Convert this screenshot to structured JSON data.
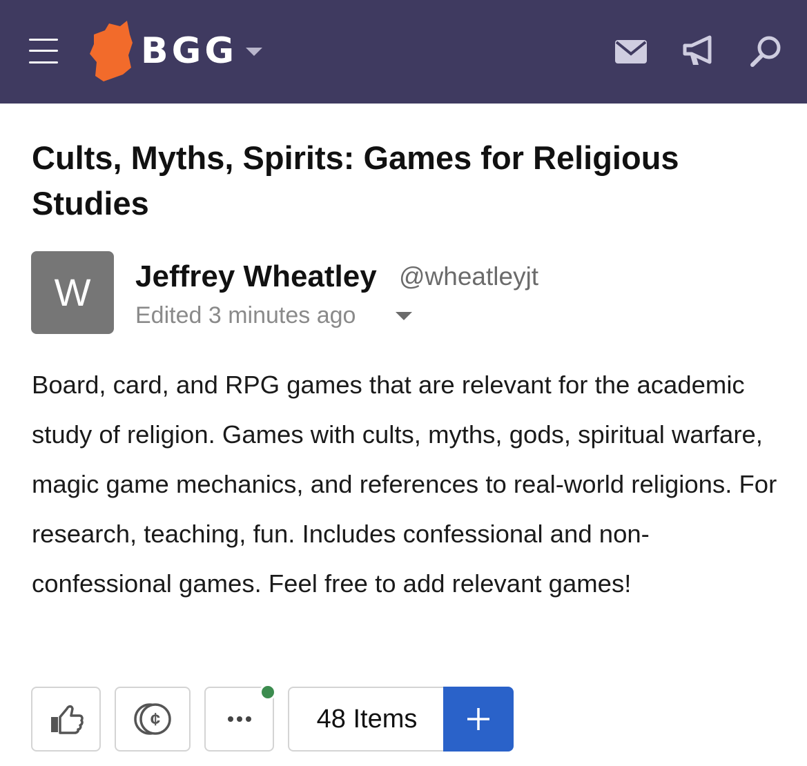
{
  "header": {
    "brand": "BGG",
    "icons": {
      "menu": "hamburger-menu-icon",
      "logo": "bgg-logo-icon",
      "brand_caret": "chevron-down-icon",
      "mail": "envelope-icon",
      "announcements": "megaphone-icon",
      "search": "search-icon"
    },
    "colors": {
      "background": "#3f3a60",
      "logo": "#f26b2b"
    }
  },
  "geeklist": {
    "title": "Cults, Myths, Spirits: Games for Religious Studies",
    "author": {
      "avatar_letter": "W",
      "name": "Jeffrey Wheatley",
      "handle": "@wheatleyjt",
      "edited": "Edited 3 minutes ago"
    },
    "description": "Board, card, and RPG games that are relevant for the academic study of religion. Games with cults, myths, gods, spiritual warfare, magic game mechanics, and references to real-world religions. For research, teaching, fun. Includes confessional and non-confessional games. Feel free to add relevant games!"
  },
  "actions": {
    "like_icon": "thumbs-up-icon",
    "tip_icon": "geekgold-coin-icon",
    "more_icon": "more-dots-icon",
    "items_label": "48 Items",
    "add_icon": "plus-icon",
    "colors": {
      "add_button": "#2a62c9",
      "notification_dot": "#3c8c4f"
    }
  }
}
